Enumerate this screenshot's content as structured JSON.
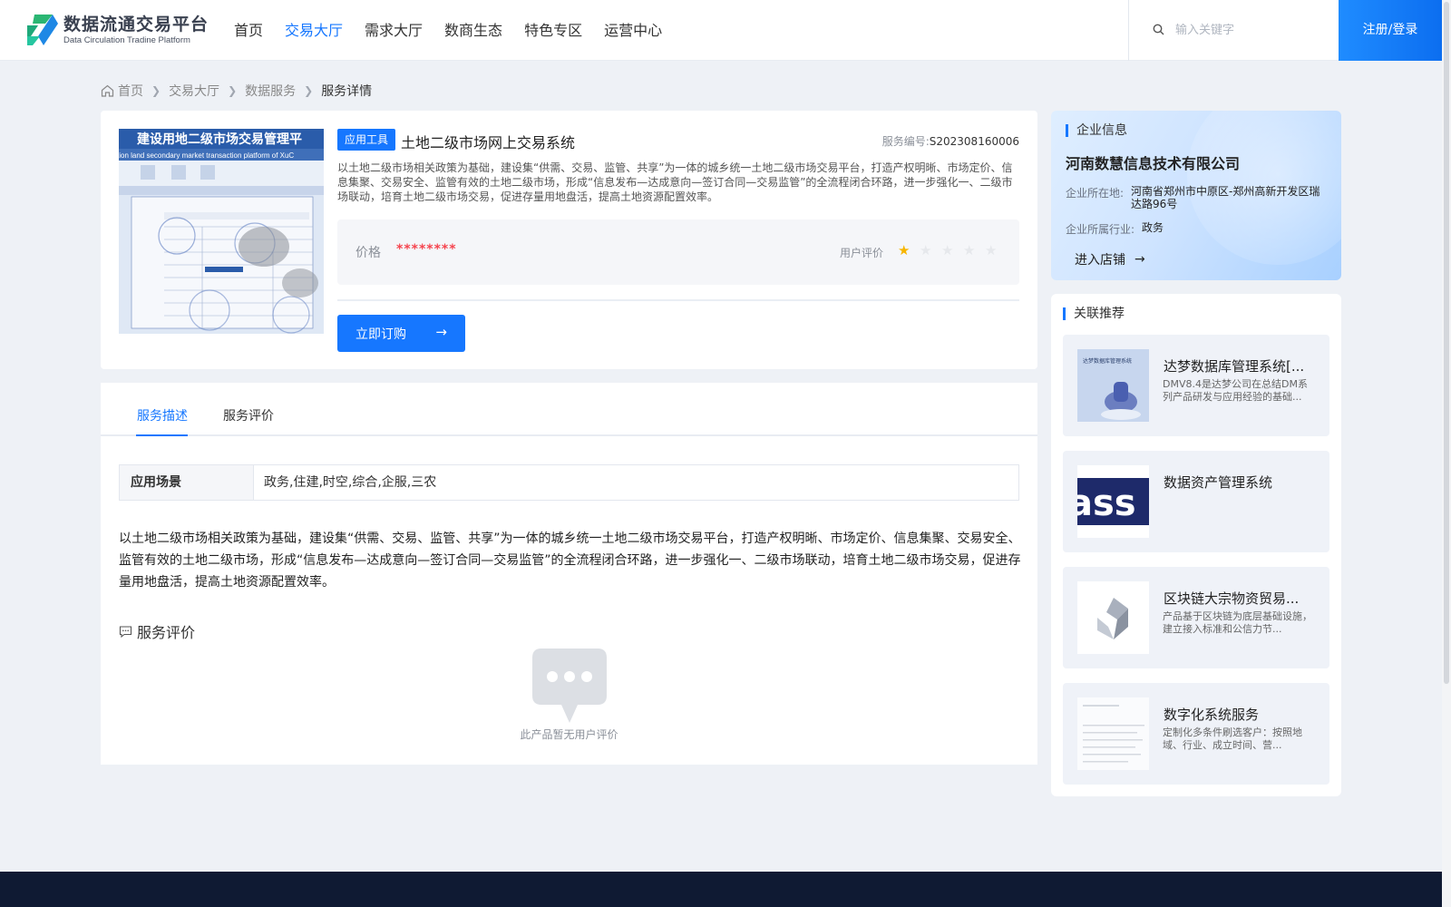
{
  "header": {
    "logo_title": "数据流通交易平台",
    "logo_subtitle": "Data Circulation Tradine Platform",
    "nav": [
      "首页",
      "交易大厅",
      "需求大厅",
      "数商生态",
      "特色专区",
      "运营中心"
    ],
    "active_nav": "交易大厅",
    "search_placeholder": "输入关键字",
    "login_label": "注册/登录"
  },
  "breadcrumb": [
    "首页",
    "交易大厅",
    "数据服务",
    "服务详情"
  ],
  "product": {
    "thumb_title": "建设用地二级市场交易管理平",
    "thumb_title_en": "ction land secondary market transaction platform of XuC",
    "tag": "应用工具",
    "title": "土地二级市场网上交易系统",
    "code_label": "服务编号:",
    "code_value": "S202308160006",
    "description": "以土地二级市场相关政策为基础，建设集“供需、交易、监管、共享”为一体的城乡统一土地二级市场交易平台，打造产权明晰、市场定价、信息集聚、交易安全、监管有效的土地二级市场，形成“信息发布—达成意向—签订合同—交易监管”的全流程闭合环路，进一步强化一、二级市场联动，培育土地二级市场交易，促进存量用地盘活，提高土地资源配置效率。",
    "price_label": "价格",
    "price_value": "********",
    "rating_label": "用户评价",
    "rating": 1,
    "rating_max": 5,
    "buy_label": "立即订购"
  },
  "detail": {
    "tabs": [
      "服务描述",
      "服务评价"
    ],
    "active_tab": "服务描述",
    "scene_label": "应用场景",
    "scene_value": "政务,住建,时空,综合,企服,三农",
    "long_description": "以土地二级市场相关政策为基础，建设集“供需、交易、监管、共享”为一体的城乡统一土地二级市场交易平台，打造产权明晰、市场定价、信息集聚、交易安全、监管有效的土地二级市场，形成“信息发布—达成意向—签订合同—交易监管”的全流程闭合环路，进一步强化一、二级市场联动，培育土地二级市场交易，促进存量用地盘活，提高土地资源配置效率。",
    "review_heading": "服务评价",
    "empty_review": "此产品暂无用户评价"
  },
  "company": {
    "section_title": "企业信息",
    "name": "河南数慧信息技术有限公司",
    "location_label": "企业所在地:",
    "location_value": "河南省郑州市中原区-郑州高新开发区瑞达路96号",
    "industry_label": "企业所属行业:",
    "industry_value": "政务",
    "enter_label": "进入店铺"
  },
  "recommend": {
    "section_title": "关联推荐",
    "items": [
      {
        "name": "达梦数据库管理系统[...",
        "desc": "DMV8.4是达梦公司在总结DM系列产品研发与应用经验的基础...",
        "thumb_text": "达梦数据库管理系统"
      },
      {
        "name": "数据资产管理系统",
        "desc": "",
        "thumb_text": "ass"
      },
      {
        "name": "区块链大宗物资贸易...",
        "desc": "产品基于区块链为底层基础设施，建立接入标准和公信力节...",
        "thumb_text": ""
      },
      {
        "name": "数字化系统服务",
        "desc": "定制化多条件刷选客户：按照地域、行业、成立时间、营...",
        "thumb_text": ""
      }
    ]
  },
  "colors": {
    "accent": "#1677ff",
    "price": "#f5454f",
    "star": "#f7b500",
    "footer": "#0f1a33"
  }
}
